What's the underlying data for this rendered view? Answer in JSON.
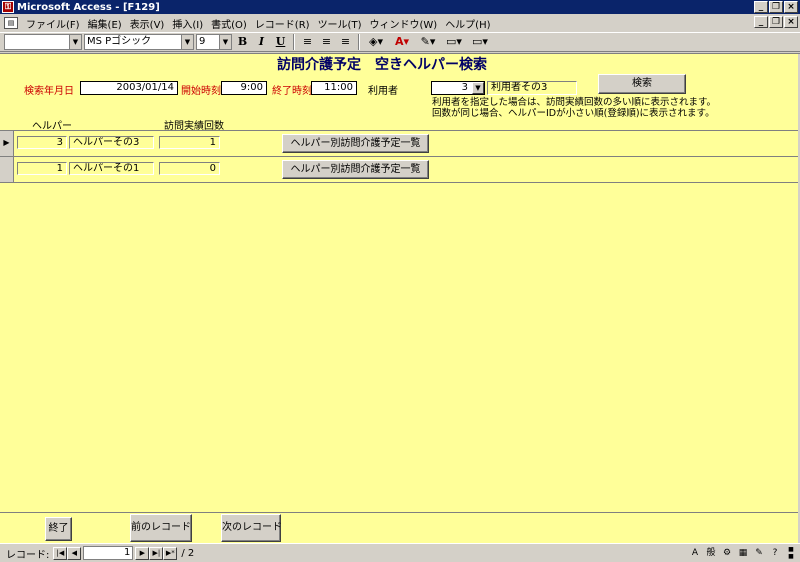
{
  "window": {
    "title": "Microsoft Access - [F129]"
  },
  "menu": [
    "ファイル(F)",
    "編集(E)",
    "表示(V)",
    "挿入(I)",
    "書式(O)",
    "レコード(R)",
    "ツール(T)",
    "ウィンドウ(W)",
    "ヘルプ(H)"
  ],
  "toolbar": {
    "object_combo": "",
    "font_name": "MS Pゴシック",
    "font_size": "9"
  },
  "form": {
    "title": "訪問介護予定　空きヘルパー検索",
    "search_date_label": "検索年月日",
    "search_date_value": "2003/01/14",
    "start_time_label": "開始時刻",
    "start_time_value": "9:00",
    "end_time_label": "終了時刻",
    "end_time_value": "11:00",
    "user_label": "利用者",
    "user_id": "3",
    "user_name": "利用者その3",
    "search_button": "検索",
    "note_line1": "利用者を指定した場合は、訪問実績回数の多い順に表示されます。",
    "note_line2": "回数が同じ場合、ヘルパーIDが小さい順(登録順)に表示されます。",
    "col_helper": "ヘルパー",
    "col_visits": "訪問実績回数",
    "rows": [
      {
        "id": "3",
        "name": "ヘルパーその3",
        "visits": "1",
        "button": "ヘルパー別訪問介護予定一覧"
      },
      {
        "id": "1",
        "name": "ヘルパーその1",
        "visits": "0",
        "button": "ヘルパー別訪問介護予定一覧"
      }
    ],
    "exit_button": "終了",
    "prev_button": "前のレコード",
    "next_button": "次のレコード"
  },
  "nav": {
    "label": "レコード:",
    "current": "1",
    "total": "/ 2"
  }
}
